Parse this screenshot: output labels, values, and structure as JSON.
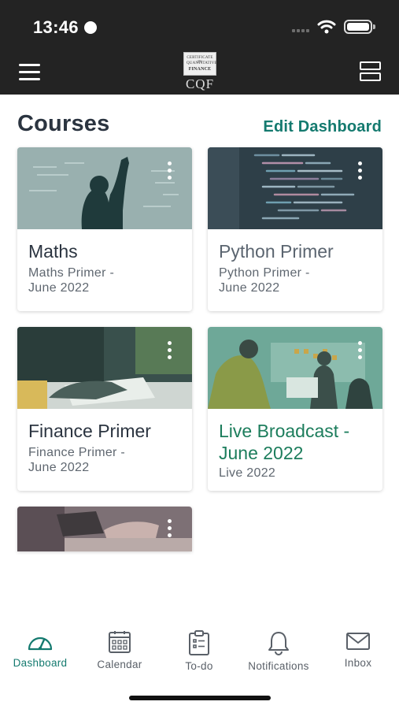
{
  "status_bar": {
    "time": "13:46"
  },
  "header": {
    "logo_lines": [
      "CERTIFICATE IN",
      "QUANTITATIVE",
      "FINANCE"
    ],
    "logo_mark": "CQF",
    "icons": {
      "menu": "hamburger-menu-icon",
      "layout": "layout-toggle-icon"
    }
  },
  "main": {
    "title": "Courses",
    "edit_label": "Edit Dashboard"
  },
  "courses": [
    {
      "title": "Maths",
      "subtitle": "Maths Primer -\nJune 2022"
    },
    {
      "title": "Python Primer",
      "subtitle": "Python Primer -\nJune 2022"
    },
    {
      "title": "Finance Primer",
      "subtitle": "Finance Primer -\nJune 2022"
    },
    {
      "title": "Live Broadcast -\nJune 2022",
      "subtitle": "Live 2022"
    }
  ],
  "nav": [
    {
      "label": "Dashboard",
      "icon": "gauge-icon",
      "active": true
    },
    {
      "label": "Calendar",
      "icon": "calendar-icon",
      "active": false
    },
    {
      "label": "To-do",
      "icon": "clipboard-icon",
      "active": false
    },
    {
      "label": "Notifications",
      "icon": "bell-icon",
      "active": false
    },
    {
      "label": "Inbox",
      "icon": "envelope-icon",
      "active": false
    }
  ],
  "colors": {
    "accent": "#147a6f",
    "header_bg": "#232323",
    "title_text": "#2b3440",
    "live_title": "#1c7d5c"
  }
}
